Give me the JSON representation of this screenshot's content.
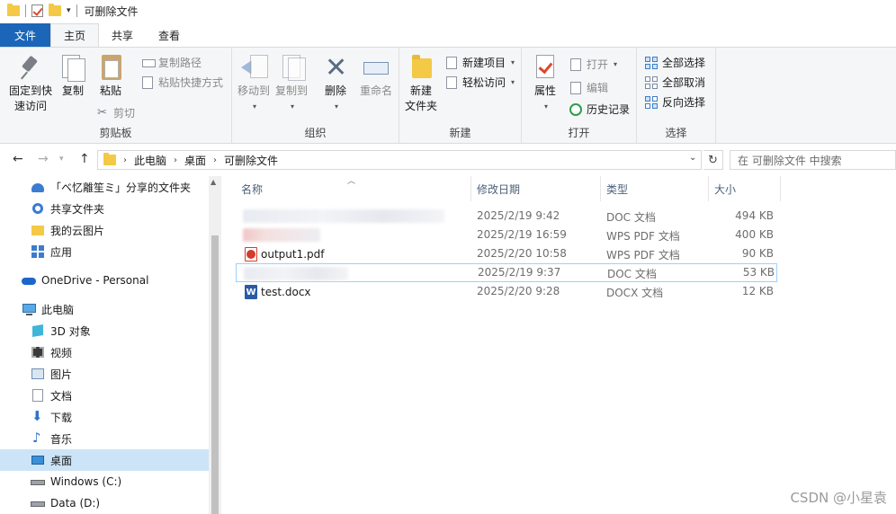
{
  "window": {
    "title": "可删除文件"
  },
  "tabs": [
    {
      "label": "文件"
    },
    {
      "label": "主页"
    },
    {
      "label": "共享"
    },
    {
      "label": "查看"
    }
  ],
  "ribbon": {
    "clipboard": {
      "group_label": "剪贴板",
      "pin_line1": "固定到快",
      "pin_line2": "速访问",
      "copy": "复制",
      "paste": "粘贴",
      "copy_path": "复制路径",
      "paste_shortcut": "粘贴快捷方式",
      "cut": "剪切"
    },
    "organize": {
      "group_label": "组织",
      "move_to": "移动到",
      "copy_to": "复制到",
      "delete": "删除",
      "rename": "重命名"
    },
    "new": {
      "group_label": "新建",
      "new_folder_line1": "新建",
      "new_folder_line2": "文件夹",
      "new_item": "新建项目",
      "easy_access": "轻松访问"
    },
    "open": {
      "group_label": "打开",
      "properties": "属性",
      "open": "打开",
      "edit": "编辑",
      "history": "历史记录"
    },
    "select": {
      "group_label": "选择",
      "select_all": "全部选择",
      "select_none": "全部取消",
      "invert": "反向选择"
    }
  },
  "address": {
    "crumbs": [
      "此电脑",
      "桌面",
      "可删除文件"
    ],
    "search_placeholder": "在 可删除文件 中搜索"
  },
  "sidebar": {
    "items": [
      {
        "label": "「ベ忆離笙ミ」分享的文件夹",
        "icon": "shared-users-icon"
      },
      {
        "label": "共享文件夹",
        "icon": "shared-folder-icon"
      },
      {
        "label": "我的云图片",
        "icon": "cloud-pictures-icon"
      },
      {
        "label": "应用",
        "icon": "apps-icon"
      },
      {
        "label": "OneDrive - Personal",
        "icon": "onedrive-icon"
      },
      {
        "label": "此电脑",
        "icon": "computer-icon"
      },
      {
        "label": "3D 对象",
        "icon": "cube-icon"
      },
      {
        "label": "视频",
        "icon": "video-icon"
      },
      {
        "label": "图片",
        "icon": "picture-icon"
      },
      {
        "label": "文档",
        "icon": "document-icon"
      },
      {
        "label": "下载",
        "icon": "download-icon"
      },
      {
        "label": "音乐",
        "icon": "music-icon"
      },
      {
        "label": "桌面",
        "icon": "desktop-icon"
      },
      {
        "label": "Windows (C:)",
        "icon": "drive-icon"
      },
      {
        "label": "Data (D:)",
        "icon": "drive-icon"
      }
    ]
  },
  "filelist": {
    "columns": [
      "名称",
      "修改日期",
      "类型",
      "大小"
    ],
    "rows": [
      {
        "name": "",
        "date": "2025/2/19 9:42",
        "type": "DOC 文档",
        "size": "494 KB"
      },
      {
        "name": "",
        "date": "2025/2/19 16:59",
        "type": "WPS PDF 文档",
        "size": "400 KB"
      },
      {
        "name": "output1.pdf",
        "date": "2025/2/20 10:58",
        "type": "WPS PDF 文档",
        "size": "90 KB"
      },
      {
        "name": "",
        "date": "2025/2/19 9:37",
        "type": "DOC 文档",
        "size": "53 KB"
      },
      {
        "name": "test.docx",
        "date": "2025/2/20 9:28",
        "type": "DOCX 文档",
        "size": "12 KB"
      }
    ]
  },
  "watermark": "CSDN @小星袁"
}
